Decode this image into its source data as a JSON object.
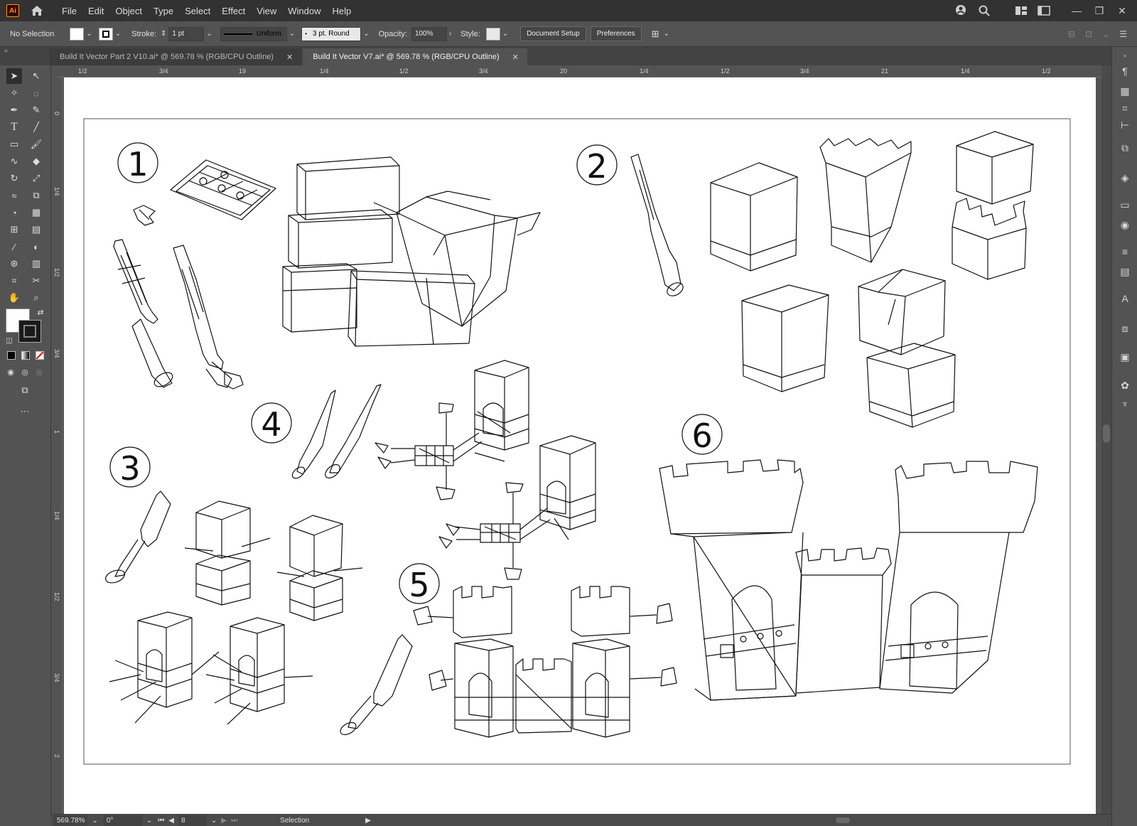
{
  "app": {
    "logo_text": "Ai"
  },
  "menu": [
    "File",
    "Edit",
    "Object",
    "Type",
    "Select",
    "Effect",
    "View",
    "Window",
    "Help"
  ],
  "control_bar": {
    "selection": "No Selection",
    "stroke_label": "Stroke:",
    "stroke_value": "1 pt",
    "profile_value": "Uniform",
    "brush_value": "3 pt. Round",
    "opacity_label": "Opacity:",
    "opacity_value": "100%",
    "style_label": "Style:",
    "document_setup": "Document Setup",
    "preferences": "Preferences"
  },
  "tabs": [
    {
      "label": "Build It Vector Part 2 V10.ai* @ 569.78 % (RGB/CPU Outline)",
      "active": false
    },
    {
      "label": "Build It Vector V7.ai* @ 569.78 % (RGB/CPU Outline)",
      "active": true
    }
  ],
  "ruler_top": [
    "1/2",
    "3/4",
    "19",
    "1/4",
    "1/2",
    "3/4",
    "20",
    "1/4",
    "1/2",
    "3/4",
    "21",
    "1/4",
    "1/2"
  ],
  "ruler_left": [
    "0",
    "1/4",
    "1/2",
    "3/4",
    "1",
    "1/4",
    "1/2",
    "3/4",
    "2"
  ],
  "steps": [
    "1",
    "2",
    "3",
    "4",
    "5",
    "6"
  ],
  "status_bar": {
    "zoom": "569.78%",
    "rotation": "0°",
    "artboard": "8",
    "tool": "Selection"
  }
}
